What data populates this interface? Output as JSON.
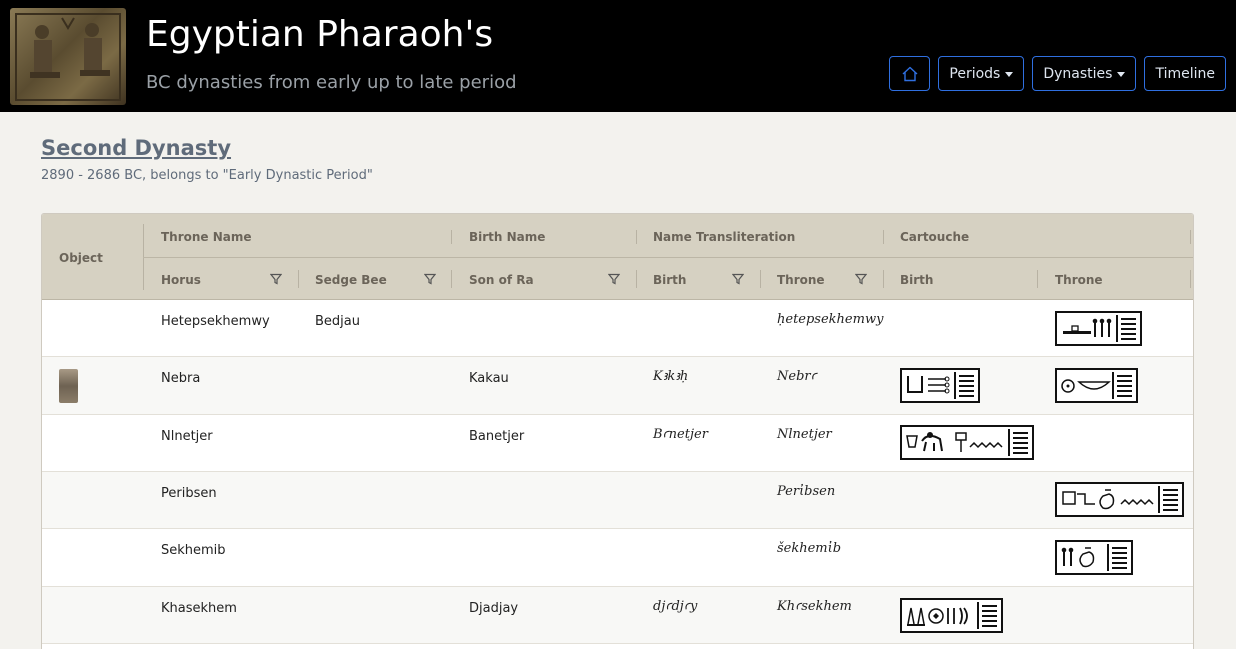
{
  "header": {
    "title": "Egyptian Pharaoh's",
    "subtitle": "BC dynasties from early up to late period",
    "logo_icon": "pharaoh-relief-image"
  },
  "nav": {
    "home_icon": "home-icon",
    "periods_label": "Periods",
    "dynasties_label": "Dynasties",
    "timeline_label": "Timeline"
  },
  "dynasty": {
    "title": "Second Dynasty",
    "subtitle": "2890 - 2686 BC, belongs to \"Early Dynastic Period\""
  },
  "table": {
    "group_headers": {
      "object": "Object",
      "throne_name": "Throne Name",
      "birth_name": "Birth Name",
      "name_transliteration": "Name Transliteration",
      "cartouche": "Cartouche"
    },
    "sub_headers": {
      "horus": "Horus",
      "sedge_bee": "Sedge Bee",
      "son_of_ra": "Son of Ra",
      "translit_birth": "Birth",
      "translit_throne": "Throne",
      "cart_birth": "Birth",
      "cart_throne": "Throne"
    },
    "rows": [
      {
        "horus": "Hetepsekhemwy",
        "sedge_bee": "Bedjau",
        "son_of_ra": "",
        "translit_birth": "",
        "translit_throne": "ḥetepsekhemwy"
      },
      {
        "horus": "Nebra",
        "sedge_bee": "",
        "son_of_ra": "Kakau",
        "translit_birth": "Kꜣkꜣḥ",
        "translit_throne": "Nebrꜥ"
      },
      {
        "horus": "Nlnetjer",
        "sedge_bee": "",
        "son_of_ra": "Banetjer",
        "translit_birth": "Bꜥnetjer",
        "translit_throne": "Nlnetjer"
      },
      {
        "horus": "Peribsen",
        "sedge_bee": "",
        "son_of_ra": "",
        "translit_birth": "",
        "translit_throne": "Perἰbsen"
      },
      {
        "horus": "Sekhemib",
        "sedge_bee": "",
        "son_of_ra": "",
        "translit_birth": "",
        "translit_throne": "šekhemἰb"
      },
      {
        "horus": "Khasekhem",
        "sedge_bee": "",
        "son_of_ra": "Djadjay",
        "translit_birth": "djꜥdjꜥy",
        "translit_throne": "Khꜥsekhem"
      }
    ]
  }
}
